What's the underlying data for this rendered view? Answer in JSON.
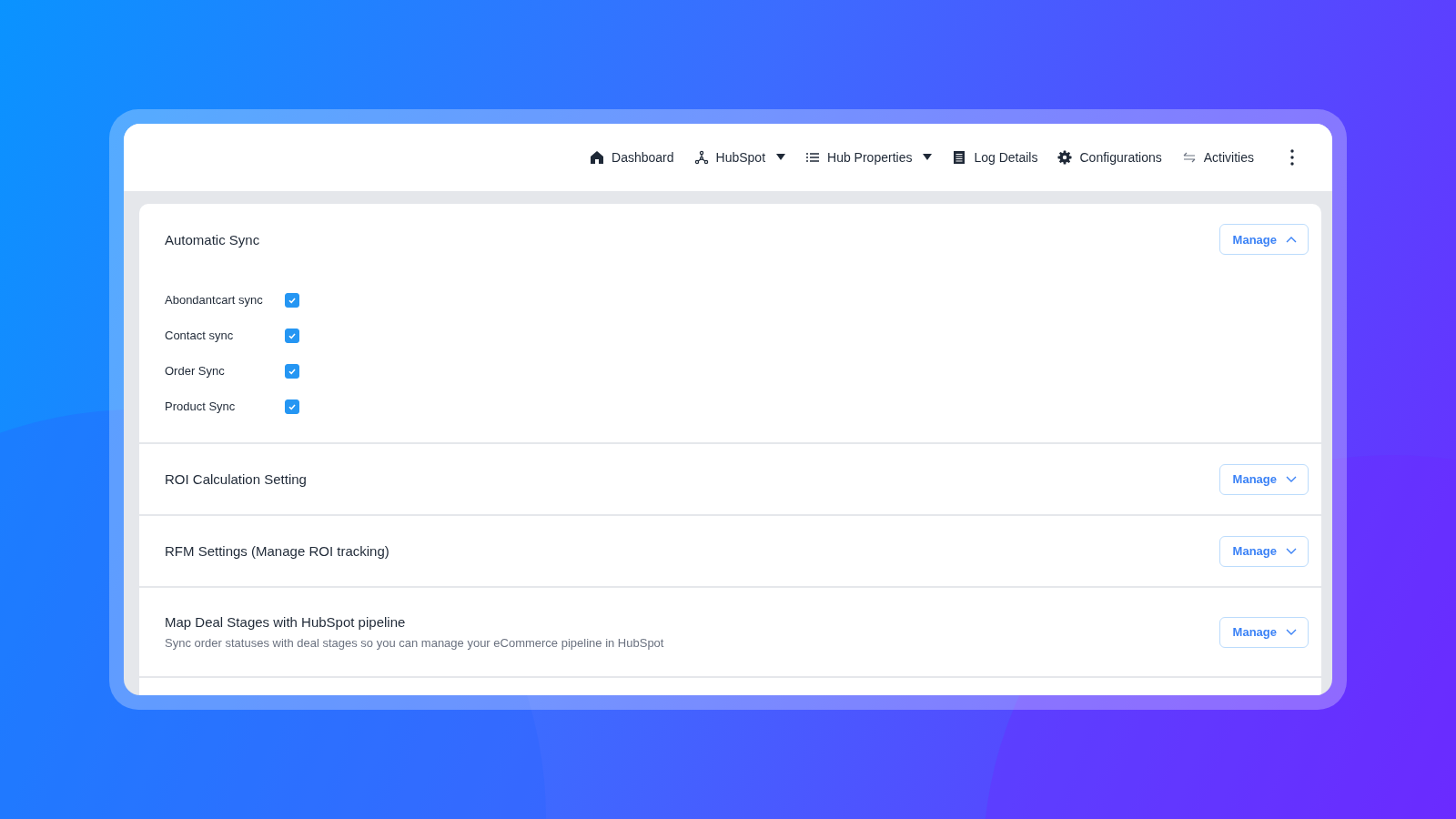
{
  "nav": {
    "items": [
      {
        "label": "Dashboard",
        "dropdown": false
      },
      {
        "label": "HubSpot",
        "dropdown": true
      },
      {
        "label": "Hub Properties",
        "dropdown": true
      },
      {
        "label": "Log Details",
        "dropdown": false
      },
      {
        "label": "Configurations",
        "dropdown": false
      },
      {
        "label": "Activities",
        "dropdown": false
      }
    ]
  },
  "sections": [
    {
      "title": "Automatic Sync",
      "button": "Manage",
      "expanded": true,
      "options": [
        {
          "label": "Abondantcart sync",
          "checked": true
        },
        {
          "label": "Contact sync",
          "checked": true
        },
        {
          "label": "Order Sync",
          "checked": true
        },
        {
          "label": "Product Sync",
          "checked": true
        }
      ]
    },
    {
      "title": "ROI Calculation Setting",
      "button": "Manage",
      "expanded": false
    },
    {
      "title": "RFM Settings (Manage ROI tracking)",
      "button": "Manage",
      "expanded": false
    },
    {
      "title": "Map Deal Stages with HubSpot pipeline",
      "description": "Sync order statuses with deal stages so you can manage your eCommerce pipeline in HubSpot",
      "button": "Manage",
      "expanded": false
    }
  ]
}
